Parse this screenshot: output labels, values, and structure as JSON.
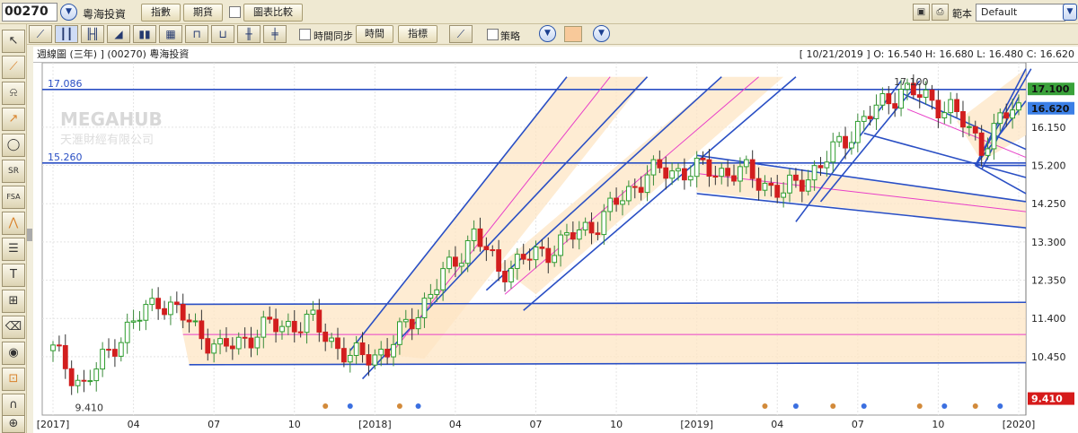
{
  "topbar": {
    "stock_code": "00270",
    "stock_name": "粵海投資",
    "btn_indicator": "指數",
    "btn_futures": "期貨",
    "chart_compare": "圖表比較",
    "template_label": "範本",
    "template_value": "Default"
  },
  "toolbar": {
    "time_sync": "時間同步",
    "btn_time": "時間",
    "btn_indicators": "指標",
    "strategy": "策略"
  },
  "chart_header": {
    "title": "週線圖 (三年) ] (00270)  粵海投資",
    "ohlc": "[ 10/21/2019 ]  O: 16.540  H: 16.680  L: 16.480  C: 16.620"
  },
  "watermark": {
    "brand": "MEGAHUB",
    "company": "天滙財經有限公司"
  },
  "colors": {
    "up": "#2e9e2e",
    "down": "#d21e1e",
    "channel_line": "#2a4fc4",
    "channel_fill": "#fde6c4",
    "pink": "#e83fc8",
    "price_tag_green": "#3aa23a",
    "price_tag_blue": "#3b7fe6",
    "price_tag_red": "#d61b1b"
  },
  "chart_data": {
    "type": "candlestick",
    "ylim": [
      9.0,
      17.75
    ],
    "y_ticks": [
      "16.150",
      "15.200",
      "14.250",
      "13.300",
      "12.350",
      "11.400",
      "10.450"
    ],
    "x_labels": [
      "[2017]",
      "04",
      "07",
      "10",
      "[2018]",
      "04",
      "07",
      "10",
      "[2019]",
      "04",
      "07",
      "10",
      "[2020]"
    ],
    "level_labels": [
      {
        "value": 17.086,
        "text": "17.086"
      },
      {
        "value": 15.26,
        "text": "15.260"
      }
    ],
    "annotations": [
      {
        "text": "9.410",
        "value": 9.41
      },
      {
        "text": "17.100",
        "value": 17.1
      }
    ],
    "price_tags": [
      {
        "value": 17.1,
        "text": "17.100",
        "color": "#3aa23a"
      },
      {
        "value": 16.62,
        "text": "16.620",
        "color": "#3b7fe6"
      },
      {
        "value": 9.41,
        "text": "9.410",
        "color": "#d61b1b"
      }
    ],
    "waypoints": [
      [
        0,
        10.6
      ],
      [
        5,
        9.7
      ],
      [
        10,
        10.8
      ],
      [
        17,
        11.9
      ],
      [
        22,
        11.3
      ],
      [
        27,
        10.6
      ],
      [
        35,
        11.2
      ],
      [
        42,
        11.3
      ],
      [
        48,
        10.4
      ],
      [
        54,
        10.6
      ],
      [
        60,
        11.8
      ],
      [
        68,
        13.5
      ],
      [
        72,
        12.6
      ],
      [
        80,
        13.1
      ],
      [
        88,
        13.8
      ],
      [
        96,
        15.0
      ],
      [
        104,
        15.1
      ],
      [
        112,
        15.0
      ],
      [
        118,
        14.5
      ],
      [
        124,
        15.2
      ],
      [
        130,
        16.2
      ],
      [
        137,
        17.1
      ],
      [
        145,
        16.6
      ],
      [
        150,
        15.7
      ],
      [
        155,
        16.62
      ]
    ],
    "events": [
      {
        "week": 44,
        "color": "orange"
      },
      {
        "week": 48,
        "color": "blue"
      },
      {
        "week": 56,
        "color": "orange"
      },
      {
        "week": 59,
        "color": "blue"
      },
      {
        "week": 115,
        "color": "orange"
      },
      {
        "week": 120,
        "color": "blue"
      },
      {
        "week": 126,
        "color": "orange"
      },
      {
        "week": 131,
        "color": "blue"
      },
      {
        "week": 140,
        "color": "orange"
      },
      {
        "week": 144,
        "color": "blue"
      },
      {
        "week": 149,
        "color": "orange"
      },
      {
        "week": 153,
        "color": "blue"
      }
    ]
  }
}
